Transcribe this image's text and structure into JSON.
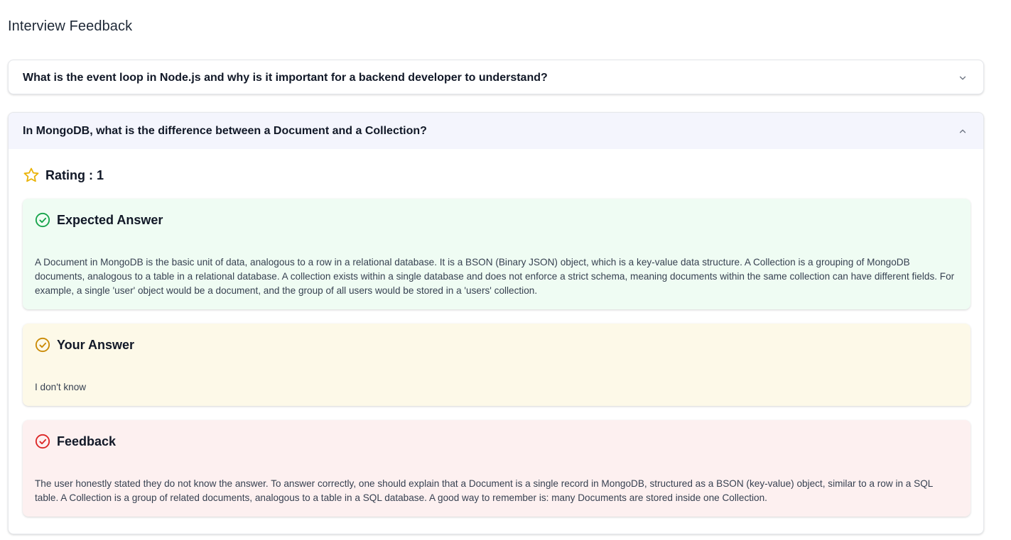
{
  "page": {
    "title": "Interview Feedback"
  },
  "questions": [
    {
      "question": "What is the event loop in Node.js and why is it important for a backend developer to understand?",
      "expanded": false,
      "chevron_icon": "chevron-down-icon"
    },
    {
      "question": "In MongoDB, what is the difference between a Document and a Collection?",
      "expanded": true,
      "chevron_icon": "chevron-up-icon",
      "rating_label": "Rating : 1",
      "rating_icon": "star-icon",
      "expected": {
        "title": "Expected Answer",
        "icon": "check-circle-icon",
        "color": "#16a34a",
        "text": "A Document in MongoDB is the basic unit of data, analogous to a row in a relational database. It is a BSON (Binary JSON) object, which is a key-value data structure. A Collection is a grouping of MongoDB documents, analogous to a table in a relational database. A collection exists within a single database and does not enforce a strict schema, meaning documents within the same collection can have different fields. For example, a single 'user' object would be a document, and the group of all users would be stored in a 'users' collection."
      },
      "yours": {
        "title": "Your Answer",
        "icon": "check-circle-icon",
        "color": "#ca8a04",
        "text": "I don't know"
      },
      "feedback": {
        "title": "Feedback",
        "icon": "check-circle-icon",
        "color": "#dc2626",
        "text": "The user honestly stated they do not know the answer. To answer correctly, one should explain that a Document is a single record in MongoDB, structured as a BSON (key-value) object, similar to a row in a SQL table. A Collection is a group of related documents, analogous to a table in a SQL database. A good way to remember is: many Documents are stored inside one Collection."
      }
    }
  ]
}
